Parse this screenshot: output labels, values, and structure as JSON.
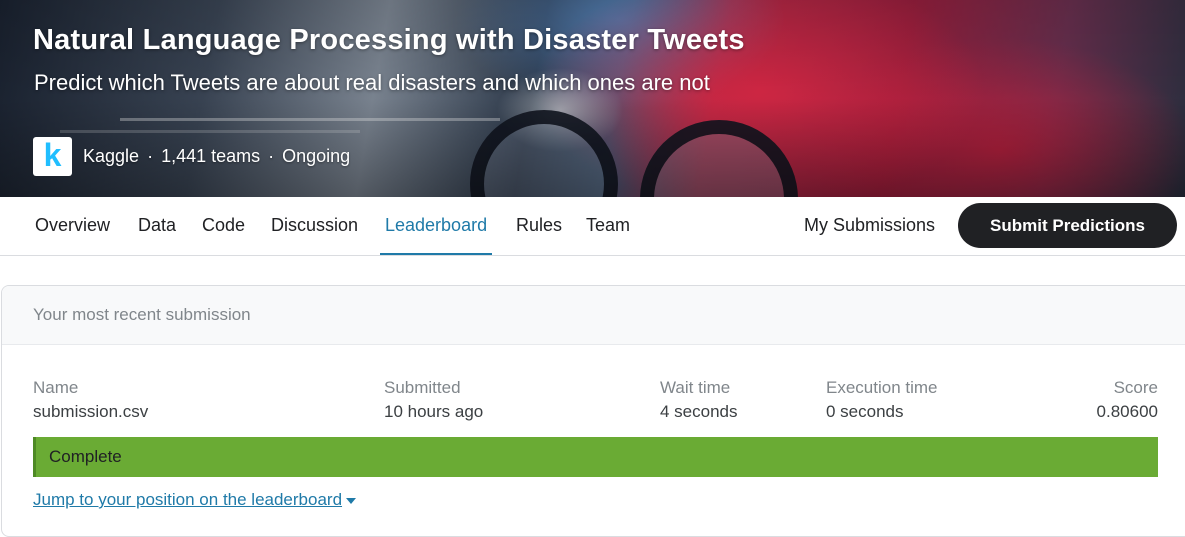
{
  "hero": {
    "title": "Natural Language Processing with Disaster Tweets",
    "subtitle": "Predict which Tweets are about real disasters and which ones are not",
    "host_logo_letter": "k",
    "host": "Kaggle",
    "separator": "·",
    "teams": "1,441 teams",
    "status": "Ongoing"
  },
  "nav": {
    "tabs": [
      {
        "label": "Overview"
      },
      {
        "label": "Data"
      },
      {
        "label": "Code"
      },
      {
        "label": "Discussion"
      },
      {
        "label": "Leaderboard",
        "active": true
      },
      {
        "label": "Rules"
      },
      {
        "label": "Team"
      }
    ],
    "my_submissions": "My Submissions",
    "submit_button": "Submit Predictions"
  },
  "submission": {
    "header": "Your most recent submission",
    "columns": [
      {
        "label": "Name",
        "value": "submission.csv"
      },
      {
        "label": "Submitted",
        "value": "10 hours ago"
      },
      {
        "label": "Wait time",
        "value": "4 seconds"
      },
      {
        "label": "Execution time",
        "value": "0 seconds"
      },
      {
        "label": "Score",
        "value": "0.80600"
      }
    ],
    "status": "Complete",
    "jump_link": "Jump to your position on the leaderboard"
  },
  "colors": {
    "accent": "#1f7aa8",
    "status_complete": "#6aab34",
    "button_dark": "#202124",
    "kaggle_blue": "#20beff"
  },
  "icons": [
    "kaggle-logo-icon",
    "caret-down-icon"
  ]
}
